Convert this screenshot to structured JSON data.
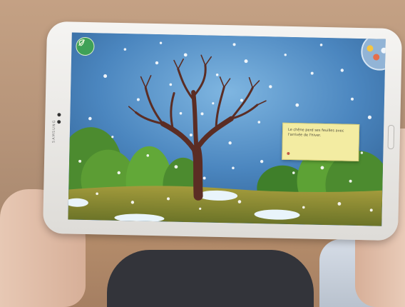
{
  "photo": {
    "scene_description_label": "Tablet showing winter tree scene",
    "device_brand": "SAMSUNG"
  },
  "app": {
    "tooltip_text": "Le chêne perd ses feuilles avec l'arrivée de l'hiver.",
    "nav_icon": "green-leaf-icon",
    "menu_icon": "season-wheel-icon"
  },
  "colors": {
    "sky": "#4b86bf",
    "ground": "#8a8c34",
    "tree": "#5b2d24",
    "tooltip": "#f3eca2"
  }
}
